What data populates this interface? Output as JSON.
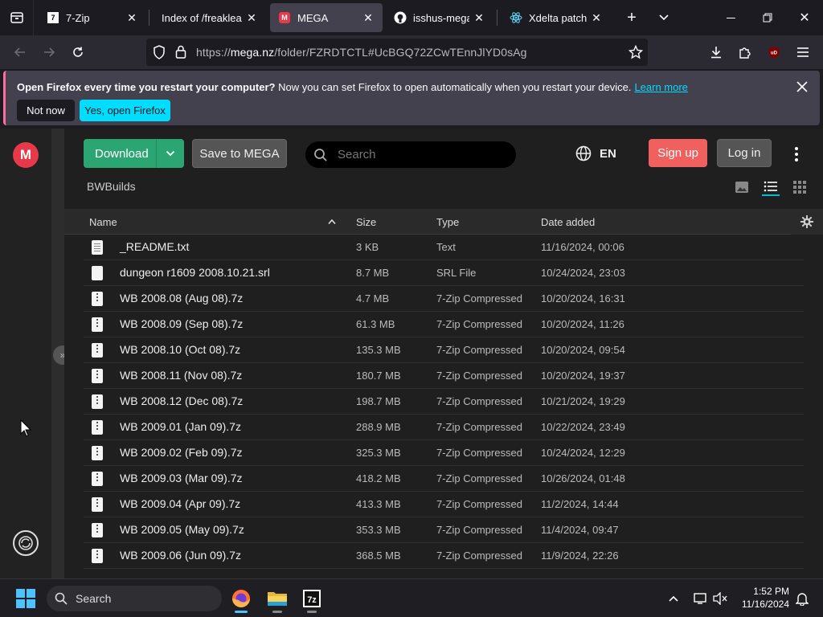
{
  "browser": {
    "tabs": [
      {
        "title": "7-Zip",
        "favicon": "7zip-icon",
        "active": false
      },
      {
        "title": "Index of /freakleak/\\",
        "favicon": "none",
        "active": false
      },
      {
        "title": "MEGA",
        "favicon": "mega-icon",
        "active": true
      },
      {
        "title": "isshus-megaarc",
        "favicon": "github-icon",
        "active": false
      },
      {
        "title": "Xdelta patcher",
        "favicon": "react-icon",
        "active": false
      }
    ],
    "url_prefix": "https://",
    "url_host": "mega.nz",
    "url_path": "/folder/FZRDTCTL#UcBGQ72ZCwTEnnJlYD0sAg"
  },
  "notification": {
    "bold": "Open Firefox every time you restart your computer?",
    "text": " Now you can set Firefox to open automatically when you restart your device.",
    "link": "Learn more",
    "not_now": "Not now",
    "yes": "Yes, open Firefox"
  },
  "mega": {
    "logo_letter": "M",
    "download_label": "Download",
    "save_label": "Save to MEGA",
    "search_placeholder": "Search",
    "language": "EN",
    "signup_label": "Sign up",
    "login_label": "Log in",
    "breadcrumb": "BWBuilds",
    "collapse_label": "»",
    "columns": {
      "name": "Name",
      "size": "Size",
      "type": "Type",
      "date": "Date added"
    },
    "files": [
      {
        "name": "_README.txt",
        "size": "3 KB",
        "type": "Text",
        "date": "11/16/2024, 00:06",
        "icon": "txt"
      },
      {
        "name": "dungeon r1609 2008.10.21.srl",
        "size": "8.7 MB",
        "type": "SRL File",
        "date": "10/24/2024, 23:03",
        "icon": "doc"
      },
      {
        "name": "WB 2008.08 (Aug 08).7z",
        "size": "4.7 MB",
        "type": "7-Zip Compressed",
        "date": "10/20/2024, 16:31",
        "icon": "zip"
      },
      {
        "name": "WB 2008.09 (Sep 08).7z",
        "size": "61.3 MB",
        "type": "7-Zip Compressed",
        "date": "10/20/2024, 11:26",
        "icon": "zip"
      },
      {
        "name": "WB 2008.10 (Oct 08).7z",
        "size": "135.3 MB",
        "type": "7-Zip Compressed",
        "date": "10/20/2024, 09:54",
        "icon": "zip"
      },
      {
        "name": "WB 2008.11 (Nov 08).7z",
        "size": "180.7 MB",
        "type": "7-Zip Compressed",
        "date": "10/20/2024, 19:37",
        "icon": "zip"
      },
      {
        "name": "WB 2008.12 (Dec 08).7z",
        "size": "198.7 MB",
        "type": "7-Zip Compressed",
        "date": "10/21/2024, 19:29",
        "icon": "zip"
      },
      {
        "name": "WB 2009.01 (Jan 09).7z",
        "size": "288.9 MB",
        "type": "7-Zip Compressed",
        "date": "10/22/2024, 23:49",
        "icon": "zip"
      },
      {
        "name": "WB 2009.02 (Feb 09).7z",
        "size": "325.3 MB",
        "type": "7-Zip Compressed",
        "date": "10/24/2024, 12:29",
        "icon": "zip"
      },
      {
        "name": "WB 2009.03 (Mar 09).7z",
        "size": "418.2 MB",
        "type": "7-Zip Compressed",
        "date": "10/26/2024, 01:48",
        "icon": "zip"
      },
      {
        "name": "WB 2009.04 (Apr 09).7z",
        "size": "413.3 MB",
        "type": "7-Zip Compressed",
        "date": "11/2/2024, 14:44",
        "icon": "zip"
      },
      {
        "name": "WB 2009.05 (May 09).7z",
        "size": "353.3 MB",
        "type": "7-Zip Compressed",
        "date": "11/4/2024, 09:47",
        "icon": "zip"
      },
      {
        "name": "WB 2009.06 (Jun 09).7z",
        "size": "368.5 MB",
        "type": "7-Zip Compressed",
        "date": "11/9/2024, 22:26",
        "icon": "zip"
      }
    ]
  },
  "taskbar": {
    "search_label": "Search",
    "time": "1:52 PM",
    "date": "11/16/2024",
    "apps": [
      "firefox-icon",
      "file-explorer-icon",
      "7zip-icon"
    ]
  },
  "colors": {
    "mega_red": "#e8394a",
    "download_green": "#2ba673",
    "signup_red": "#f0605e",
    "firefox_cyan": "#00ddff"
  }
}
